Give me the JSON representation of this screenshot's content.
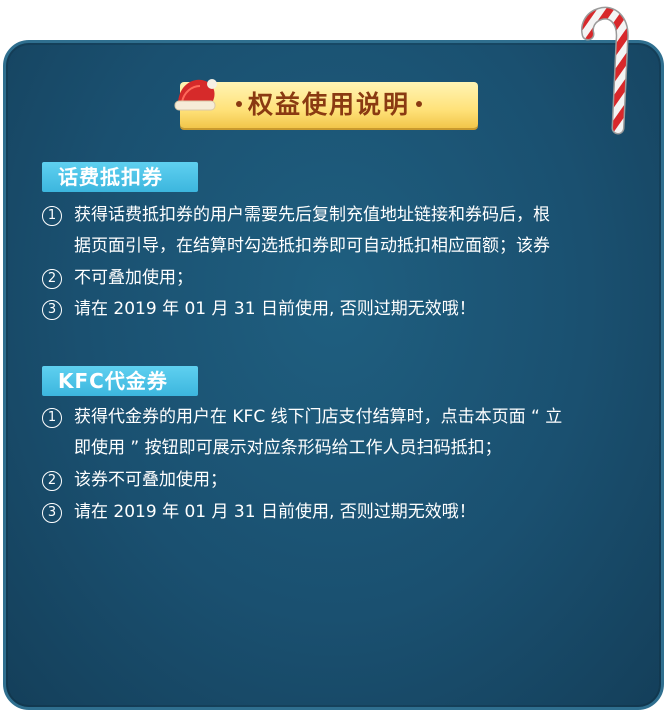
{
  "banner": {
    "title": "权益使用说明"
  },
  "sections": [
    {
      "tag": "话费抵扣券",
      "items": [
        {
          "num": "1",
          "text": "获得话费抵扣券的用户需要先后复制充值地址链接和券码后，根\n据页面引导，在结算时勾选抵扣券即可自动抵扣相应面额；该券"
        },
        {
          "num": "2",
          "text": "不可叠加使用；"
        },
        {
          "num": "3",
          "text": "请在 2019 年 01 月 31 日前使用, 否则过期无效哦！"
        }
      ]
    },
    {
      "tag": "KFC代金券",
      "items": [
        {
          "num": "1",
          "text": "获得代金券的用户在 KFC 线下门店支付结算时，点击本页面 “ 立\n即使用 ” 按钮即可展示对应条形码给工作人员扫码抵扣；"
        },
        {
          "num": "2",
          "text": "该券不可叠加使用；"
        },
        {
          "num": "3",
          "text": "请在 2019 年 01 月 31 日前使用, 否则过期无效哦！"
        }
      ]
    }
  ],
  "colors": {
    "card_bg": "#1a5070",
    "banner": "#ffe27a",
    "banner_text": "#8a3a12",
    "tag_bg": "#3cb6de",
    "text": "#ffffff"
  },
  "icons": {
    "hat": "santa-hat-icon",
    "candy": "candy-cane-icon"
  }
}
